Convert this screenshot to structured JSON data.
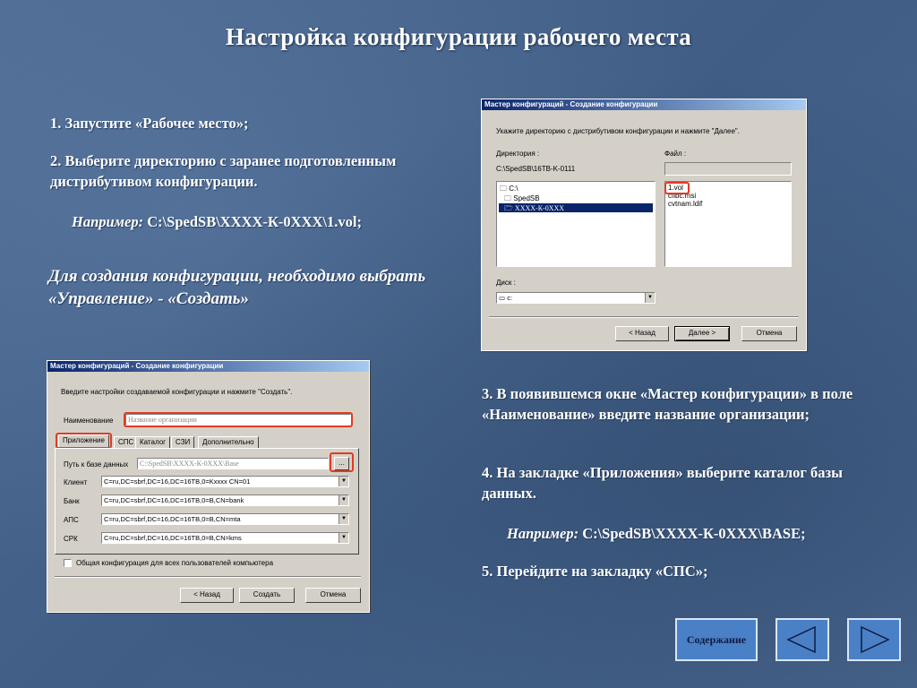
{
  "slide": {
    "title": "Настройка конфигурации рабочего места",
    "step1": "1.   Запустите «Рабочее место»;",
    "step2": "2.   Выберите директорию с заранее подготовленным дистрибутивом конфигурации.",
    "example1_label": "Например:",
    "example1_value": " C:\\SpedSB\\XXXX-К-0XXX\\1.vol;",
    "note": "Для создания конфигурации, необходимо выбрать «Управление» - «Создать»",
    "step3": "3.   В появившемся окне «Мастер конфигурации» в поле «Наименование» введите название организации;",
    "step4": "4.   На закладке «Приложения» выберите каталог базы данных.",
    "example2_label": "Например:",
    "example2_value": " C:\\SpedSB\\XXXX-К-0XXX\\BASE;",
    "step5": "5.   Перейдите на закладку «СПС»;"
  },
  "wizard1": {
    "caption": "Мастер конфигураций - Создание конфигурации",
    "instruction": "Укажите директорию с дистрибутивом конфигурации и нажмите \"Далее\".",
    "dir_label": "Директория :",
    "dir_value": "C:\\SpedSB\\16TB-K-0111",
    "file_label": "Файл :",
    "folders": [
      "C:\\",
      "SpedSB",
      "XXXX-К-0XXX"
    ],
    "files": [
      "1.vol",
      "cflbc.msi",
      "cvtnam.ldif"
    ],
    "drive_label": "Диск :",
    "drive_value": "c:",
    "back_btn": "< Назад",
    "next_btn": "Далее >",
    "cancel_btn": "Отмена"
  },
  "wizard2": {
    "caption": "Мастер конфигураций - Создание конфигурации",
    "instruction": "Введите настройки создаваемой конфигурации и нажмите \"Создать\".",
    "name_label": "Наименование",
    "name_value": "Название организации",
    "tabs": [
      "Приложение",
      "СПС",
      "Каталог",
      "СЗИ",
      "Дополнительно"
    ],
    "path_label": "Путь к базе данных",
    "path_value": "C:\\SpedSB\\XXXX-К-0XXX\\Base",
    "browse_btn": "...",
    "rows": [
      {
        "label": "Клиент",
        "value": "C=ru,DC=sbrf,DC=16,DC=16TB,0=Kxxxx CN=01"
      },
      {
        "label": "Банк",
        "value": "C=ru,DC=sbrf,DC=16,DC=16TB,0=B,CN=bank"
      },
      {
        "label": "АПС",
        "value": "C=ru,DC=sbrf,DC=16,DC=16TB,0=B,CN=mta"
      },
      {
        "label": "СРК",
        "value": "C=ru,DC=sbrf,DC=16,DC=16TB,0=B,CN=kms"
      }
    ],
    "shared_label": "Общая конфигурация для всех пользователей компьютера",
    "back_btn": "< Назад",
    "create_btn": "Создать",
    "cancel_btn": "Отмена"
  },
  "nav": {
    "contents": "Содержание",
    "prev_icon": "triangle-left-icon",
    "next_icon": "triangle-right-icon"
  }
}
